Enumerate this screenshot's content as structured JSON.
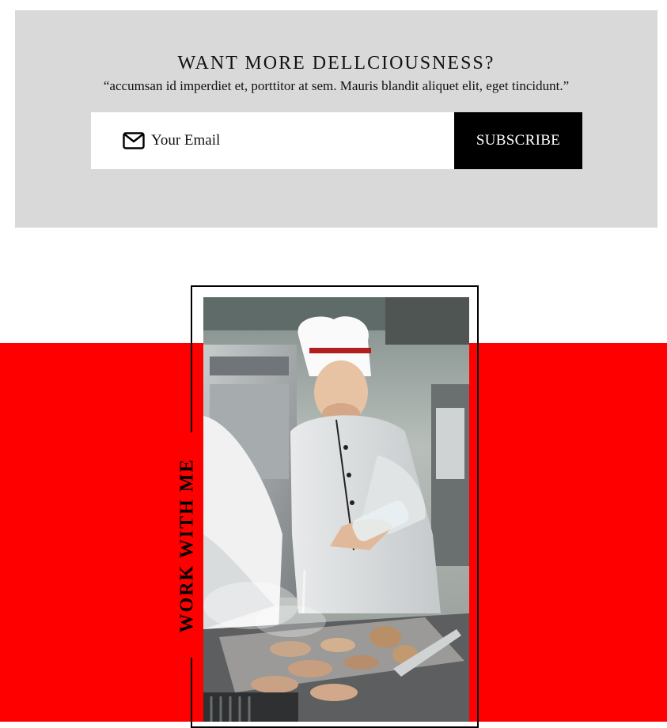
{
  "newsletter": {
    "title": "WANT MORE DELLCIOUSNESS?",
    "quote": "“accumsan id imperdiet et, porttitor at sem. Mauris blandit aliquet elit, eget tincidunt.”",
    "email_placeholder": "Your Email",
    "subscribe_label": "SUBSCRIBE"
  },
  "work": {
    "vertical_label": "WORK WITH ME",
    "accent_color": "#ff0000"
  }
}
